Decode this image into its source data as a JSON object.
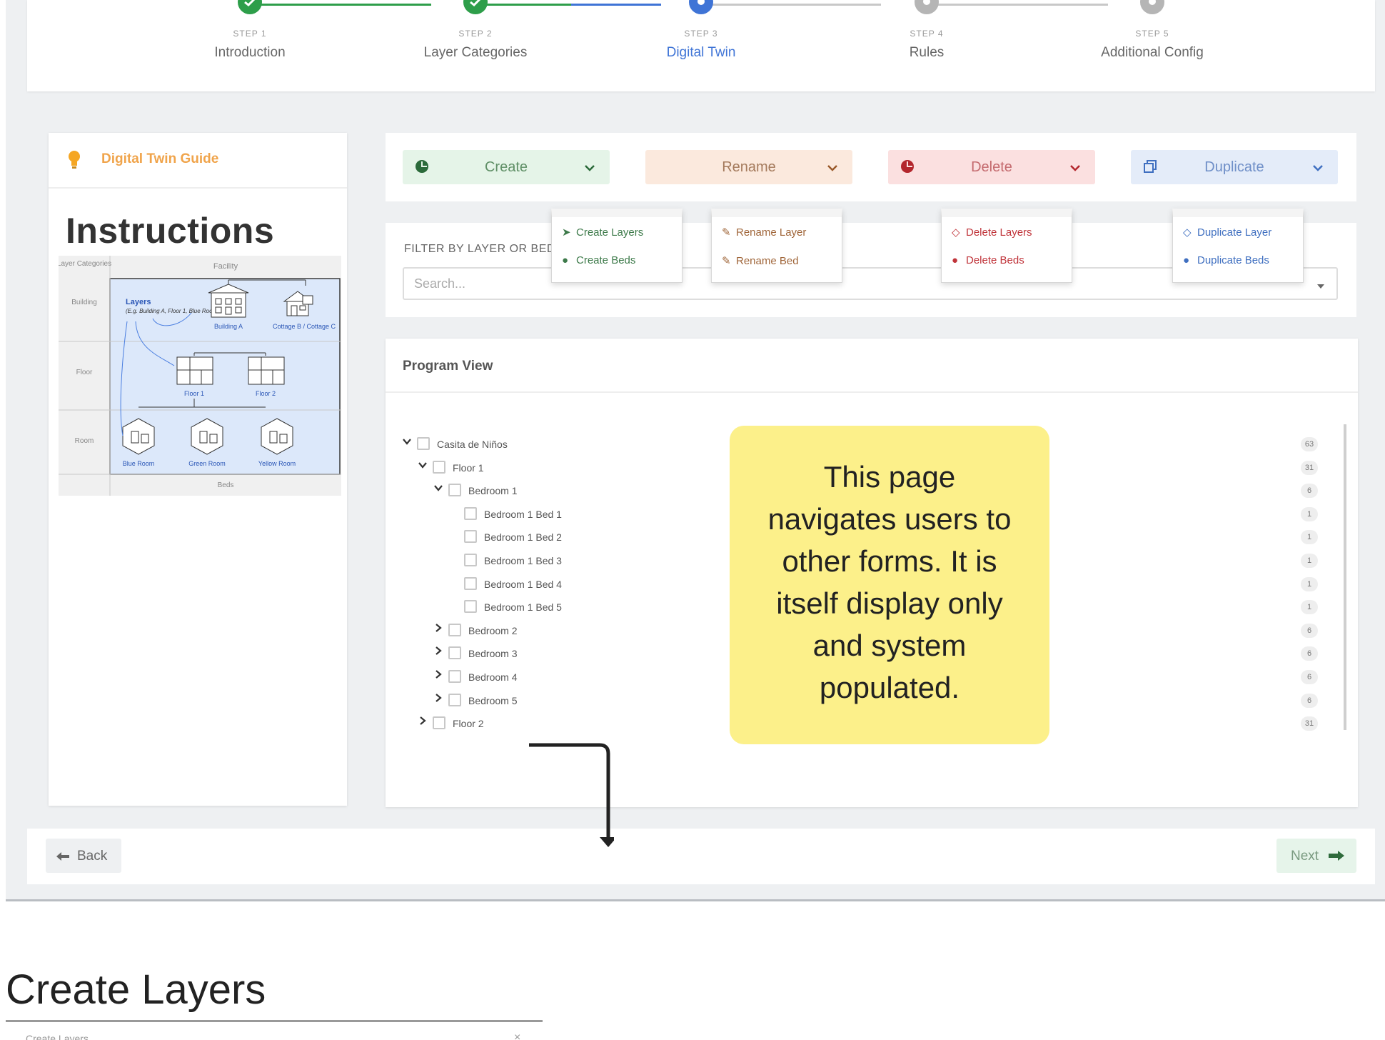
{
  "stepper": {
    "steps": [
      {
        "small": "STEP 1",
        "name": "Introduction",
        "state": "done"
      },
      {
        "small": "STEP 2",
        "name": "Layer Categories",
        "state": "done"
      },
      {
        "small": "STEP 3",
        "name": "Digital Twin",
        "state": "active"
      },
      {
        "small": "STEP 4",
        "name": "Rules",
        "state": "todo"
      },
      {
        "small": "STEP 5",
        "name": "Additional Config",
        "state": "todo"
      }
    ]
  },
  "guide": {
    "title": "Digital Twin Guide",
    "heading": "Instructions",
    "diagram": {
      "col_header_left": "Layer Categories",
      "col_header_right": "Facility",
      "row_building": "Building",
      "row_floor": "Floor",
      "row_room": "Room",
      "footer_beds": "Beds",
      "layers_title": "Layers",
      "layers_example": "(E.g. Building A, Floor 1, Blue Room)",
      "building_a": "Building A",
      "cottages": "Cottage B / Cottage C",
      "floor1": "Floor 1",
      "floor2": "Floor 2",
      "blue_room": "Blue Room",
      "green_room": "Green Room",
      "yellow_room": "Yellow Room"
    }
  },
  "toolbar": {
    "create": "Create",
    "rename": "Rename",
    "delete": "Delete",
    "duplicate": "Duplicate"
  },
  "menus": {
    "create": [
      "Create Layers",
      "Create Beds"
    ],
    "rename": [
      "Rename Layer",
      "Rename Bed"
    ],
    "delete": [
      "Delete Layers",
      "Delete Beds"
    ],
    "duplicate": [
      "Duplicate Layer",
      "Duplicate Beds"
    ]
  },
  "filter": {
    "label": "FILTER BY LAYER OR BED",
    "placeholder": "Search..."
  },
  "program": {
    "title": "Program View",
    "rows": [
      {
        "label": "Casita de Niños",
        "count": "63",
        "level": 0,
        "toggle": "open"
      },
      {
        "label": "Floor 1",
        "count": "31",
        "level": 1,
        "toggle": "open"
      },
      {
        "label": "Bedroom 1",
        "count": "6",
        "level": 2,
        "toggle": "open"
      },
      {
        "label": "Bedroom 1 Bed 1",
        "count": "1",
        "level": 3,
        "toggle": "none"
      },
      {
        "label": "Bedroom 1 Bed 2",
        "count": "1",
        "level": 3,
        "toggle": "none"
      },
      {
        "label": "Bedroom 1 Bed 3",
        "count": "1",
        "level": 3,
        "toggle": "none"
      },
      {
        "label": "Bedroom 1 Bed 4",
        "count": "1",
        "level": 3,
        "toggle": "none"
      },
      {
        "label": "Bedroom 1 Bed 5",
        "count": "1",
        "level": 3,
        "toggle": "none"
      },
      {
        "label": "Bedroom 2",
        "count": "6",
        "level": 2,
        "toggle": "closed"
      },
      {
        "label": "Bedroom 3",
        "count": "6",
        "level": 2,
        "toggle": "closed"
      },
      {
        "label": "Bedroom 4",
        "count": "6",
        "level": 2,
        "toggle": "closed"
      },
      {
        "label": "Bedroom 5",
        "count": "6",
        "level": 2,
        "toggle": "closed"
      },
      {
        "label": "Floor 2",
        "count": "31",
        "level": 1,
        "toggle": "closed"
      }
    ]
  },
  "sticky_note": "This page navigates users to other forms. It is itself display only and system populated.",
  "footer": {
    "back": "Back",
    "next": "Next"
  },
  "section": {
    "title": "Create Layers",
    "subtitle": "Create Layers",
    "close": "×"
  },
  "colors": {
    "done": "#2e9e4a",
    "active": "#3f74d6",
    "todo": "#b5b5b5",
    "create_bg": "#e5f4e8",
    "create_fg": "#2b8a3e",
    "rename_bg": "#fbe9dd",
    "rename_fg": "#b05c2a",
    "delete_bg": "#fbe0e0",
    "delete_fg": "#c0343a",
    "duplicate_bg": "#e4ecf9",
    "duplicate_fg": "#3f74d6",
    "sticky": "#fcf08a"
  }
}
